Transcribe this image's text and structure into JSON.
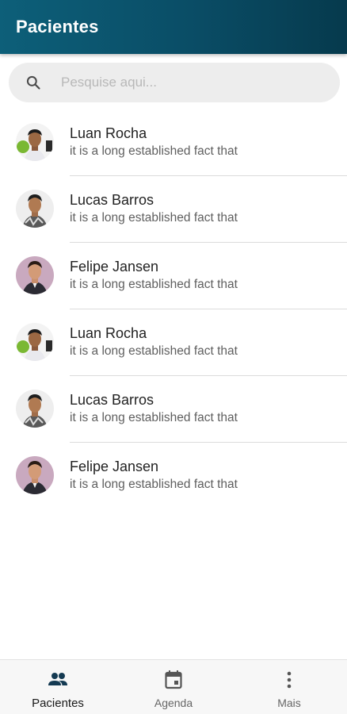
{
  "header": {
    "title": "Pacientes"
  },
  "search": {
    "placeholder": "Pesquise aqui..."
  },
  "patients": [
    {
      "name": "Luan Rocha",
      "description": "it is a long established fact that",
      "avatar": "luan"
    },
    {
      "name": "Lucas Barros",
      "description": "it is a long established fact that",
      "avatar": "lucas"
    },
    {
      "name": "Felipe Jansen",
      "description": "it is a long established fact that",
      "avatar": "felipe"
    },
    {
      "name": "Luan Rocha",
      "description": "it is a long established fact that",
      "avatar": "luan"
    },
    {
      "name": "Lucas Barros",
      "description": "it is a long established fact that",
      "avatar": "lucas"
    },
    {
      "name": "Felipe Jansen",
      "description": "it is a long established fact that",
      "avatar": "felipe"
    }
  ],
  "bottom_nav": [
    {
      "label": "Pacientes",
      "icon": "people-icon",
      "active": true
    },
    {
      "label": "Agenda",
      "icon": "calendar-icon",
      "active": false
    },
    {
      "label": "Mais",
      "icon": "more-vertical-icon",
      "active": false
    }
  ],
  "colors": {
    "header_start": "#0d5f79",
    "header_end": "#063a4d",
    "search_bg": "#ededed",
    "nav_bg": "#f7f7f7"
  }
}
